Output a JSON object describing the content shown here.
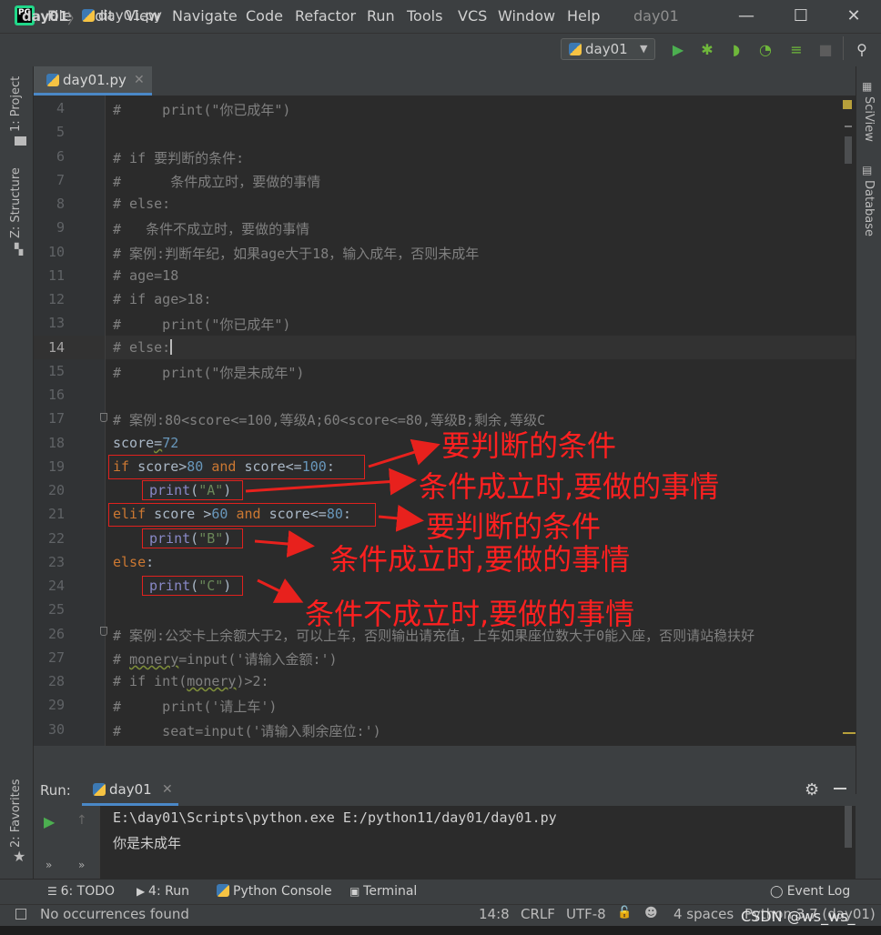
{
  "app": {
    "menu": [
      "File",
      "Edit",
      "View",
      "Navigate",
      "Code",
      "Refactor",
      "Run",
      "Tools",
      "VCS",
      "Window",
      "Help"
    ],
    "window_title": "day01",
    "window_buttons": {
      "minimize": "—",
      "maximize": "☐",
      "close": "✕"
    }
  },
  "navbar": {
    "project": "day01",
    "separator": "〉",
    "file": "day01.py",
    "run_config": "day01",
    "run_config_arrow": "▼"
  },
  "left_strip": {
    "project_tab": "1: Project",
    "structure_tab": "Z: Structure",
    "favorites_tab": "2: Favorites"
  },
  "right_strip": {
    "sciview_tab": "SciView",
    "database_tab": "Database"
  },
  "editor": {
    "tab_label": "day01.py",
    "tab_close": "✕",
    "current_line": 14,
    "line_numbers": [
      "4",
      "5",
      "6",
      "7",
      "8",
      "9",
      "10",
      "11",
      "12",
      "13",
      "14",
      "15",
      "16",
      "17",
      "18",
      "19",
      "20",
      "21",
      "22",
      "23",
      "24",
      "25",
      "26",
      "27",
      "28",
      "29",
      "30"
    ],
    "lines": {
      "l4": "#     print(\"你已成年\")",
      "l6": "# if 要判断的条件:",
      "l7": "#      条件成立时，要做的事情",
      "l8": "# else:",
      "l9": "#   条件不成立时，要做的事情",
      "l10": "# 案例:判断年纪，如果age大于18，输入成年，否则未成年",
      "l11": "# age=18",
      "l12": "# if age>18:",
      "l13": "#     print(\"你已成年\")",
      "l14": "# else:",
      "l15": "#     print(\"你是未成年\")",
      "l17": "# 案例:80<score<=100,等级A;60<score<=80,等级B;剩余,等级C",
      "l18_var": "score",
      "l18_eq": "=",
      "l18_num": "72",
      "l19_if": "if",
      "l19_var": " score>",
      "l19_n1": "80",
      "l19_and": " and",
      "l19_rest": " score<=",
      "l19_n2": "100",
      "l19_colon": ":",
      "l20_fn": "print",
      "l20_p1": "(",
      "l20_str": "\"A\"",
      "l20_p2": ")",
      "l21_kw": "elif",
      "l21_var": " score >",
      "l21_n1": "60",
      "l21_and": " and",
      "l21_rest": " score<=",
      "l21_n2": "80",
      "l21_colon": ":",
      "l22_fn": "print",
      "l22_p1": "(",
      "l22_str": "\"B\"",
      "l22_p2": ")",
      "l23_kw": "else",
      "l23_colon": ":",
      "l24_fn": "print",
      "l24_p1": "(",
      "l24_str": "\"C\"",
      "l24_p2": ")",
      "l26": "# 案例:公交卡上余额大于2，可以上车，否则输出请充值，上车如果座位数大于0能入座，否则请站稳扶好",
      "l27a": "# ",
      "l27b": "monery",
      "l27c": "=input('请输入金额:')",
      "l28a": "# if int(",
      "l28b": "monery",
      "l28c": ")>2:",
      "l29": "#     print('请上车')",
      "l30": "#     seat=input('请输入剩余座位:')"
    }
  },
  "annotations": {
    "a1": "要判断的条件",
    "a2": "条件成立时,要做的事情",
    "a3": "要判断的条件",
    "a4": "条件成立时,要做的事情",
    "a5": "条件不成立时,要做的事情"
  },
  "run_panel": {
    "label": "Run:",
    "tab": "day01",
    "tab_close": "✕",
    "command": "E:\\day01\\Scripts\\python.exe E:/python11/day01/day01.py",
    "output": "你是未成年"
  },
  "tool_tabs": {
    "todo": "6: TODO",
    "run": "4: Run",
    "console": "Python Console",
    "terminal": "Terminal",
    "event_log": "Event Log"
  },
  "status_bar": {
    "message": "No occurrences found",
    "position": "14:8",
    "line_sep": "CRLF",
    "encoding": "UTF-8",
    "indent": "4 spaces",
    "interpreter": "Python 3.7 (day01)",
    "watermark": "CSDN @ws_ws_"
  },
  "colors": {
    "accent": "#4a88c7",
    "annotation": "#ff2020",
    "keyword": "#cc7832",
    "number": "#6897bb",
    "string": "#6a8759",
    "comment": "#808080",
    "run_green": "#4caf50"
  }
}
